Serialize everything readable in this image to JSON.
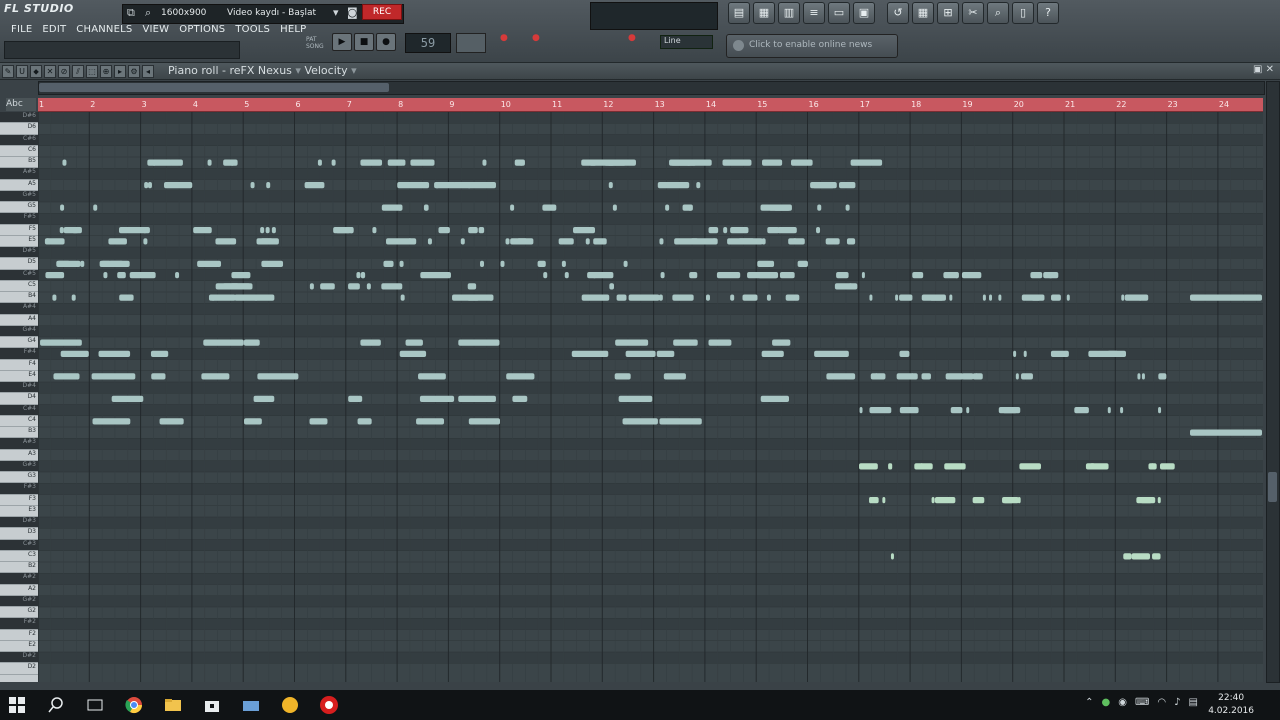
{
  "app": {
    "name": "FL STUDIO"
  },
  "recorder": {
    "resolution": "1600x900",
    "title": "Video kaydı - Başlat",
    "rec_label": "REC"
  },
  "menu": [
    "FILE",
    "EDIT",
    "CHANNELS",
    "VIEW",
    "OPTIONS",
    "TOOLS",
    "HELP"
  ],
  "transport": {
    "tempo": "59",
    "pattern_label": "PAT",
    "song_label": "SONG",
    "snap": "Line"
  },
  "online": {
    "hint": "Click to enable online news"
  },
  "piano_roll": {
    "window_title": "Piano roll - reFX Nexus",
    "target": "Velocity",
    "abc_label": "Abc"
  },
  "ruler": {
    "bars": [
      "1",
      "2",
      "3",
      "4",
      "5",
      "6",
      "7",
      "8",
      "9",
      "10",
      "11",
      "12",
      "13",
      "14",
      "15",
      "16",
      "17",
      "18",
      "19",
      "20",
      "21",
      "22",
      "23",
      "24"
    ]
  },
  "keyboard": {
    "keys": [
      {
        "name": "D#6",
        "black": true
      },
      {
        "name": "D6",
        "black": false
      },
      {
        "name": "C#6",
        "black": true
      },
      {
        "name": "C6",
        "black": false
      },
      {
        "name": "B5",
        "black": false
      },
      {
        "name": "A#5",
        "black": true
      },
      {
        "name": "A5",
        "black": false
      },
      {
        "name": "G#5",
        "black": true
      },
      {
        "name": "G5",
        "black": false
      },
      {
        "name": "F#5",
        "black": true
      },
      {
        "name": "F5",
        "black": false
      },
      {
        "name": "E5",
        "black": false
      },
      {
        "name": "D#5",
        "black": true
      },
      {
        "name": "D5",
        "black": false
      },
      {
        "name": "C#5",
        "black": true
      },
      {
        "name": "C5",
        "black": false
      },
      {
        "name": "B4",
        "black": false
      },
      {
        "name": "A#4",
        "black": true
      },
      {
        "name": "A4",
        "black": false
      },
      {
        "name": "G#4",
        "black": true
      },
      {
        "name": "G4",
        "black": false
      },
      {
        "name": "F#4",
        "black": true
      },
      {
        "name": "F4",
        "black": false
      },
      {
        "name": "E4",
        "black": false
      },
      {
        "name": "D#4",
        "black": true
      },
      {
        "name": "D4",
        "black": false
      },
      {
        "name": "C#4",
        "black": true
      },
      {
        "name": "C4",
        "black": false
      },
      {
        "name": "B3",
        "black": false
      },
      {
        "name": "A#3",
        "black": true
      },
      {
        "name": "A3",
        "black": false
      },
      {
        "name": "G#3",
        "black": true
      },
      {
        "name": "G3",
        "black": false
      },
      {
        "name": "F#3",
        "black": true
      },
      {
        "name": "F3",
        "black": false
      },
      {
        "name": "E3",
        "black": false
      },
      {
        "name": "D#3",
        "black": true
      },
      {
        "name": "D3",
        "black": false
      },
      {
        "name": "C#3",
        "black": true
      },
      {
        "name": "C3",
        "black": false
      },
      {
        "name": "B2",
        "black": false
      },
      {
        "name": "A#2",
        "black": true
      },
      {
        "name": "A2",
        "black": false
      },
      {
        "name": "G#2",
        "black": true
      },
      {
        "name": "G2",
        "black": false
      },
      {
        "name": "F#2",
        "black": true
      },
      {
        "name": "F2",
        "black": false
      },
      {
        "name": "E2",
        "black": false
      },
      {
        "name": "D#2",
        "black": true
      },
      {
        "name": "D2",
        "black": false
      }
    ]
  },
  "colors": {
    "note": "#a9c6c4",
    "note_light": "#b8dcc4",
    "ruler": "#c85860",
    "grid_bg": "#3b4549"
  },
  "taskbar": {
    "time": "22:40",
    "date": "4.02.2016"
  }
}
